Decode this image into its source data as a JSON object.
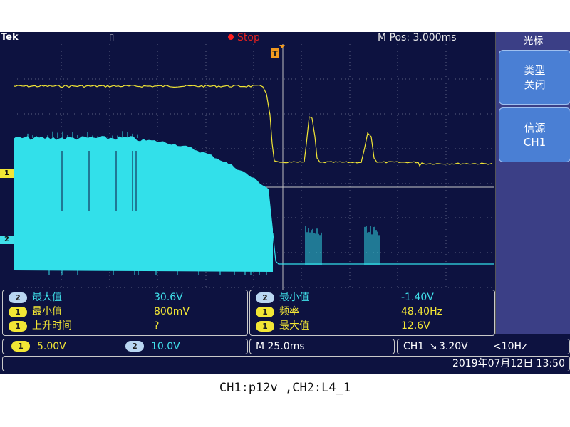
{
  "scope": {
    "brand": "Tek",
    "trigger_mode_glyph": "⎍",
    "run_state": "Stop",
    "m_pos": "M Pos: 3.000ms",
    "trigger_marker": "T"
  },
  "side_panel": {
    "title": "光标",
    "buttons": [
      {
        "line1": "类型",
        "line2": "关闭"
      },
      {
        "line1": "信源",
        "line2": "CH1"
      }
    ]
  },
  "measurements_left": [
    {
      "ch": "2",
      "name": "最大值",
      "value": "30.6V"
    },
    {
      "ch": "1",
      "name": "最小值",
      "value": "800mV"
    },
    {
      "ch": "1",
      "name": "上升时间",
      "value": "?"
    }
  ],
  "measurements_right": [
    {
      "ch": "2",
      "name": "最小值",
      "value": "-1.40V"
    },
    {
      "ch": "1",
      "name": "频率",
      "value": "48.40Hz"
    },
    {
      "ch": "1",
      "name": "最大值",
      "value": "12.6V"
    }
  ],
  "channel_status": {
    "ch1_badge": "1",
    "ch1_scale": "5.00V",
    "ch2_badge": "2",
    "ch2_scale": "10.0V"
  },
  "timebase": "M 25.0ms",
  "trigger": {
    "source": "CH1",
    "slope": "↘",
    "level": "3.20V",
    "freq": "<10Hz"
  },
  "datetime": "2019年07月12日 13:50",
  "channel_markers": {
    "ch1": "1",
    "ch2": "2"
  },
  "caption": "CH1:p12v ,CH2:L4_1",
  "colors": {
    "ch1": "#f2e635",
    "ch2": "#40e0ea",
    "background": "#0d1240",
    "panel": "#3b3f86"
  }
}
